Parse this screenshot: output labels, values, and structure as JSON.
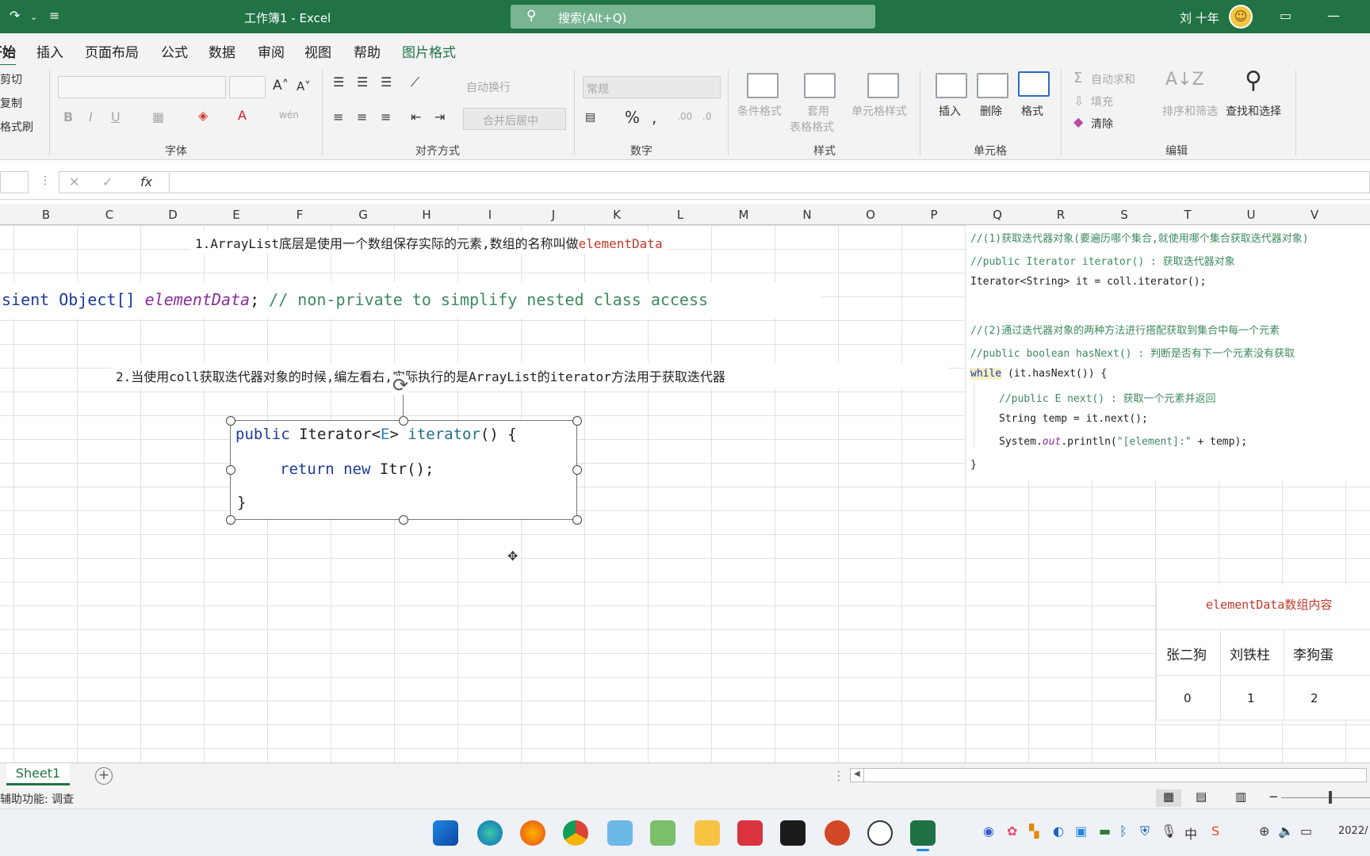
{
  "titlebar": {
    "title": "工作簿1  -  Excel",
    "search_placeholder": "搜索(Alt+Q)",
    "user": "刘 十年"
  },
  "tabs": [
    "开始",
    "插入",
    "页面布局",
    "公式",
    "数据",
    "审阅",
    "视图",
    "帮助",
    "图片格式"
  ],
  "ribbon": {
    "clipboard": [
      "剪切",
      "复制",
      "格式刷"
    ],
    "font_group": "字体",
    "align_group": "对齐方式",
    "wrap": "自动换行",
    "merge": "合并后居中",
    "number_format": "常规",
    "number_group": "数字",
    "styles": {
      "cond": "条件格式",
      "table1": "套用",
      "table2": "表格格式",
      "cell": "单元格样式",
      "group": "样式"
    },
    "cells": {
      "insert": "插入",
      "delete": "删除",
      "format": "格式",
      "group": "单元格"
    },
    "editing": {
      "autosum": "自动求和",
      "fill": "填充",
      "clear": "清除",
      "sort": "排序和筛选",
      "find": "查找和选择",
      "group": "编辑"
    }
  },
  "formula": {
    "fx": "fx"
  },
  "columns": [
    "B",
    "C",
    "D",
    "E",
    "F",
    "G",
    "H",
    "I",
    "J",
    "K",
    "L",
    "M",
    "N",
    "O",
    "P",
    "Q",
    "R",
    "S",
    "T",
    "U",
    "V"
  ],
  "notes": {
    "note1_text": "1.ArrayList底层是使用一个数组保存实际的元素,数组的名称叫做",
    "note1_red": "elementData",
    "code1_a": "sient Object[] ",
    "code1_b": "elementData",
    "code1_c": "; ",
    "code1_d": "// non-private to simplify nested class access",
    "note2": "2.当使用coll获取迭代器对象的时候,编左看右,实际执行的是ArrayList的iterator方法用于获取迭代器"
  },
  "snippet": {
    "l1_kw": "public",
    "l1_a": " Iterator<",
    "l1_e": "E",
    "l1_b": "> ",
    "l1_m": "iterator",
    "l1_c": "() {",
    "l2_kw1": "return",
    "l2_kw2": "new",
    "l2_a": " Itr();",
    "l3": "}"
  },
  "right_code": [
    {
      "t": "//(1)获取迭代器对象(要遍历哪个集合,就使用哪个集合获取迭代器对象)",
      "c": "cm"
    },
    {
      "t": "//public Iterator iterator() : 获取迭代器对象",
      "c": "cm"
    },
    {
      "t": "Iterator<String> it = coll.iterator();",
      "c": ""
    },
    {
      "t": "",
      "c": ""
    },
    {
      "t": "//(2)通过迭代器对象的两种方法进行搭配获取到集合中每一个元素",
      "c": "cm"
    },
    {
      "t": "//public boolean hasNext() : 判断是否有下一个元素没有获取",
      "c": "cm"
    }
  ],
  "right_code2": {
    "while_kw": "while",
    "while_rest": " (it.hasNext()) {",
    "l_next": "//public E next() : 获取一个元素并返回",
    "l_temp": "String temp = it.next();",
    "l_print_a": "System.",
    "l_print_out": "out",
    "l_print_b": ".println(",
    "l_print_str": "\"[element]:\"",
    "l_print_c": " + temp);",
    "l_close": "}"
  },
  "array_table": {
    "title_red": "elementData",
    "title_rest": "数组内容",
    "values": [
      "张二狗",
      "刘铁柱",
      "李狗蛋"
    ],
    "indices": [
      "0",
      "1",
      "2"
    ]
  },
  "sheet": {
    "name": "Sheet1",
    "status": "辅助功能: 调查"
  },
  "clock": "2022/"
}
